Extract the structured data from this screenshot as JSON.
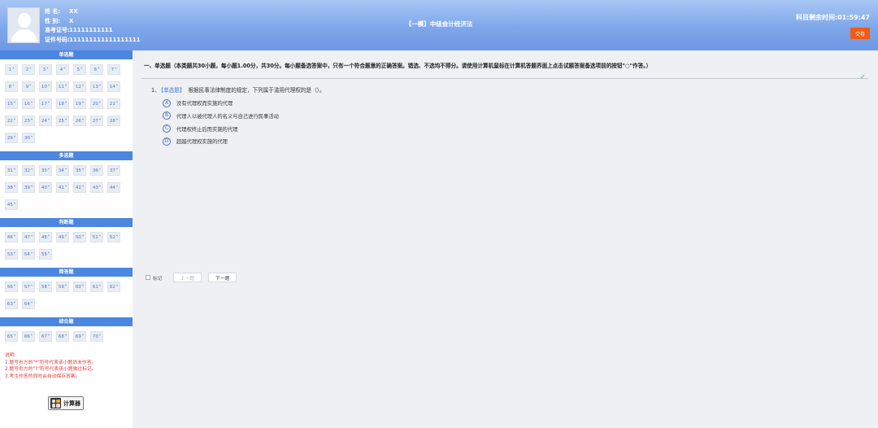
{
  "header": {
    "candidate": [
      {
        "label": "姓 名:",
        "value": "XX"
      },
      {
        "label": "性 别:",
        "value": "X"
      },
      {
        "label": "准考证号:",
        "value": "11111111111"
      },
      {
        "label": "证件号码:",
        "value": "111111111111111111"
      }
    ],
    "subject": "【一模】中级会计经济法",
    "timer_label": "科目剩余时间:",
    "timer_value": "01:59:47",
    "submit_label": "交卷"
  },
  "sidebar": {
    "sections": [
      {
        "title": "单选题",
        "questions": [
          "1",
          "2",
          "3",
          "4",
          "5",
          "6",
          "7",
          "8",
          "9",
          "10",
          "11",
          "12",
          "13",
          "14",
          "15",
          "16",
          "17",
          "18",
          "19",
          "20",
          "21",
          "22",
          "23",
          "24",
          "25",
          "26",
          "27",
          "28",
          "29",
          "30"
        ]
      },
      {
        "title": "多选题",
        "questions": [
          "31",
          "32",
          "33",
          "34",
          "35",
          "36",
          "37",
          "38",
          "39",
          "40",
          "41",
          "42",
          "43",
          "44",
          "45"
        ]
      },
      {
        "title": "判断题",
        "questions": [
          "46",
          "47",
          "48",
          "49",
          "50",
          "51",
          "52",
          "53",
          "54",
          "55"
        ]
      },
      {
        "title": "简答题",
        "questions": [
          "56",
          "57",
          "58",
          "59",
          "60",
          "61",
          "62",
          "63",
          "64"
        ]
      },
      {
        "title": "综合题",
        "questions": [
          "65",
          "66",
          "67",
          "68",
          "69",
          "70"
        ]
      }
    ],
    "question_suffix": "*",
    "notes": [
      "说明:",
      "1.题号右方的\"*\"符号代表该小题尚未作答。",
      "2.题号右方的\"?\"符号代表该小题做过标记。",
      "3.考生作答的同时会自动保存答案。"
    ],
    "calculator_label": "计算器"
  },
  "main": {
    "section_description": "一、单选题（本类题共30小题，每小题1.00分，共30分。每小题备选答案中，只有一个符合题意的正确答案。错选、不选均不得分。请使用计算机鼠标在计算机答题界面上点击试题答案备选项前的按钮\"○\"作答。）",
    "question_number": "1、",
    "question_tag": "【单选题】",
    "question_text": "根据民事法律制度的规定，下列属于滥用代理权的是（）。",
    "options": [
      {
        "letter": "A",
        "text": "没有代理权而实施的代理"
      },
      {
        "letter": "B",
        "text": "代理人以被代理人的名义与自己进行民事活动"
      },
      {
        "letter": "C",
        "text": "代理权终止后而实施的代理"
      },
      {
        "letter": "D",
        "text": "超越代理权实施的代理"
      }
    ],
    "mark_label": "标记",
    "prev_label": "上一题",
    "next_label": "下一题"
  },
  "icons": {
    "mark": "bookmark-check-icon",
    "calculator": "calculator-icon",
    "avatar": "user-avatar-icon"
  },
  "colors": {
    "header_blue": "#7ea7ea",
    "section_blue": "#4b86e0",
    "submit_orange": "#f5590f",
    "note_red": "#e23b3b"
  }
}
